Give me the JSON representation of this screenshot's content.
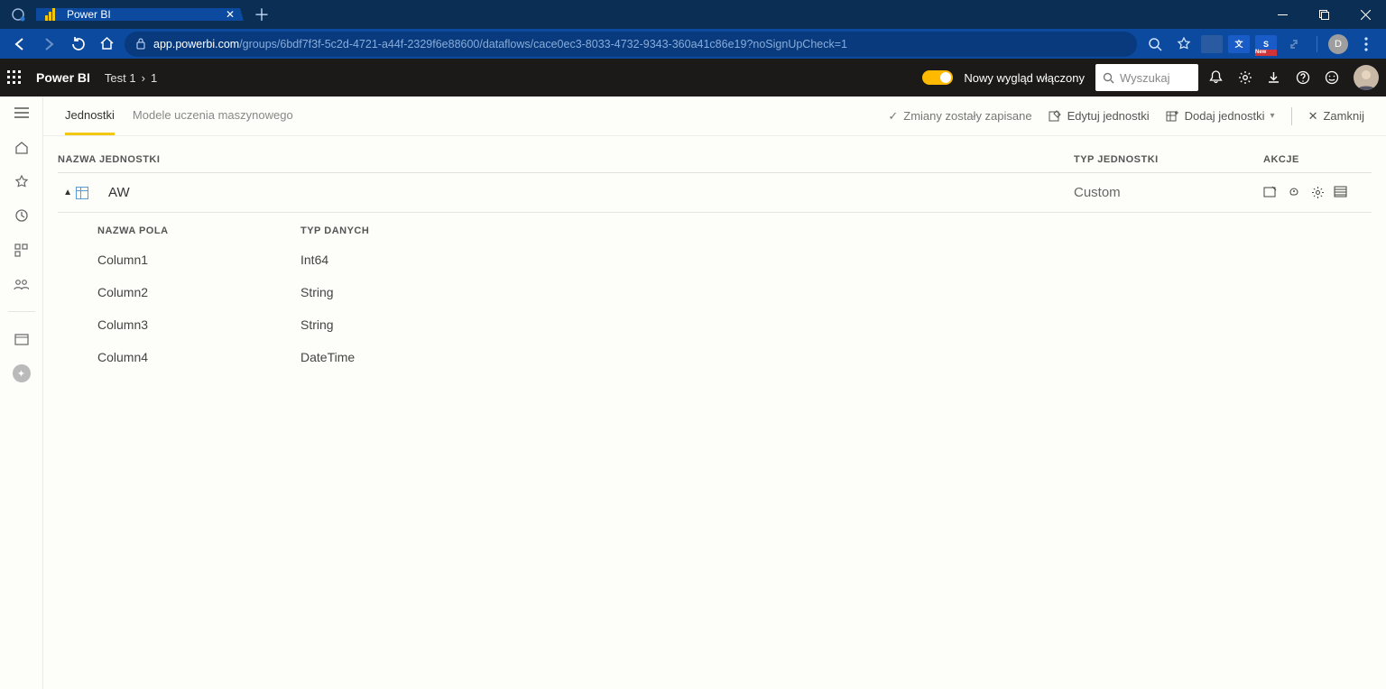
{
  "browser": {
    "tab_title": "Power BI",
    "url_host": "app.powerbi.com",
    "url_path": "/groups/6bdf7f3f-5c2d-4721-a44f-2329f6e88600/dataflows/cace0ec3-8033-4732-9343-360a41c86e19?noSignUpCheck=1",
    "profile_badge": "D",
    "ext_new_label": "New"
  },
  "pb_header": {
    "brand": "Power BI",
    "crumb_workspace": "Test 1",
    "crumb_item": "1",
    "new_look_label": "Nowy wygląd włączony",
    "search_placeholder": "Wyszukaj"
  },
  "toolbar": {
    "tabs": {
      "entities": "Jednostki",
      "ml": "Modele uczenia maszynowego"
    },
    "status": "Zmiany zostały zapisane",
    "edit": "Edytuj jednostki",
    "add": "Dodaj jednostki",
    "close": "Zamknij"
  },
  "list": {
    "headers": {
      "name": "NAZWA JEDNOSTKI",
      "type": "TYP JEDNOSTKI",
      "actions": "AKCJE"
    },
    "entity": {
      "name": "AW",
      "type": "Custom"
    },
    "field_headers": {
      "name": "NAZWA POLA",
      "type": "TYP DANYCH"
    },
    "fields": [
      {
        "name": "Column1",
        "type": "Int64"
      },
      {
        "name": "Column2",
        "type": "String"
      },
      {
        "name": "Column3",
        "type": "String"
      },
      {
        "name": "Column4",
        "type": "DateTime"
      }
    ]
  }
}
